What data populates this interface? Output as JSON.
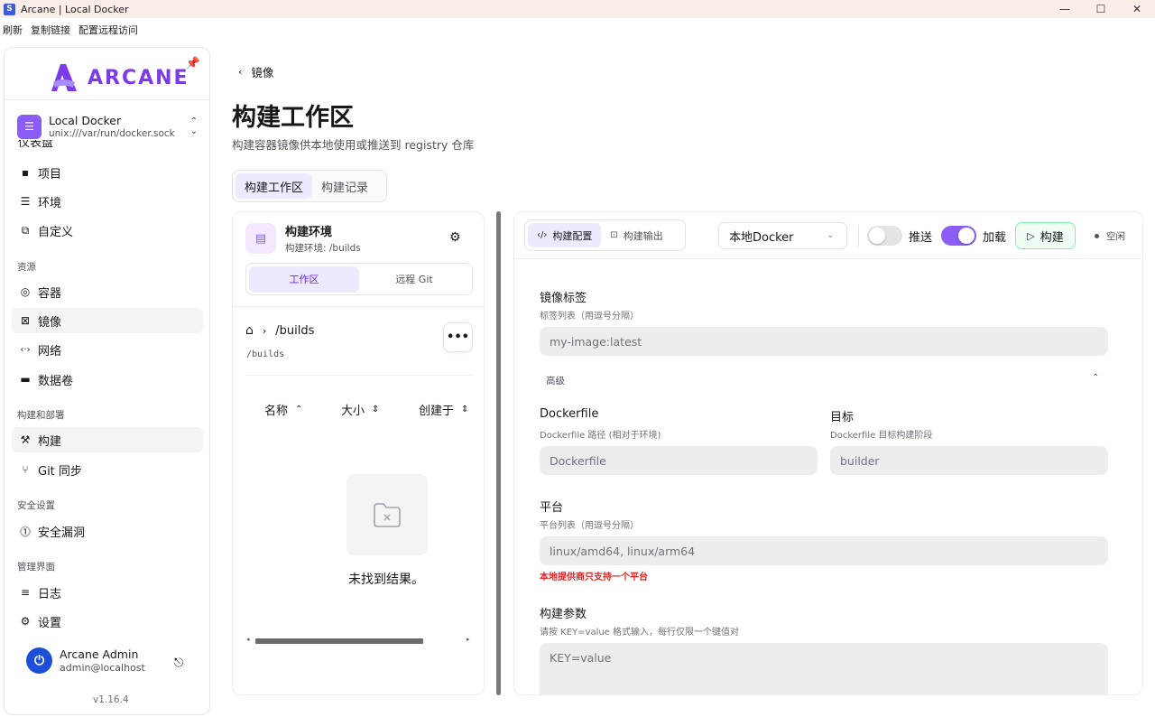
{
  "window": {
    "title": "Arcane | Local Docker",
    "icon_letter": "S",
    "minimize": "—",
    "maximize": "☐",
    "close": "✕"
  },
  "menubar": {
    "refresh": "刷新",
    "copy_link": "复制链接",
    "remote": "配置远程访问"
  },
  "sidebar": {
    "brand": "ARCANE",
    "env_name": "Local Docker",
    "env_socket": "unix:///var/run/docker.sock",
    "partial_item": "仪表盘",
    "items_top": [
      {
        "label": "项目",
        "icon": "▪"
      },
      {
        "label": "环境",
        "icon": "☰"
      },
      {
        "label": "自定义",
        "icon": "⧉"
      }
    ],
    "section_resources": "资源",
    "items_resources": [
      {
        "label": "容器",
        "icon": "◎"
      },
      {
        "label": "镜像",
        "icon": "⊠"
      },
      {
        "label": "网络",
        "icon": "‹·›"
      },
      {
        "label": "数据卷",
        "icon": "▬"
      }
    ],
    "section_build": "构建和部署",
    "items_build": [
      {
        "label": "构建",
        "icon": "⚒"
      },
      {
        "label": "Git 同步",
        "icon": "⑂"
      }
    ],
    "section_security": "安全设置",
    "items_security": [
      {
        "label": "安全漏洞",
        "icon": "⓵"
      }
    ],
    "section_admin": "管理界面",
    "items_admin": [
      {
        "label": "日志",
        "icon": "≡"
      },
      {
        "label": "设置",
        "icon": "⚙"
      }
    ],
    "user_name": "Arcane Admin",
    "user_email": "admin@localhost",
    "version": "v1.16.4"
  },
  "header": {
    "back_label": "镜像",
    "title": "构建工作区",
    "subtitle": "构建容器镜像供本地使用或推送到 registry 仓库",
    "tabs": [
      "构建工作区",
      "构建记录"
    ]
  },
  "left_panel": {
    "env_title": "构建环境",
    "env_sub": "构建环境: /builds",
    "seg": [
      "工作区",
      "远程 Git"
    ],
    "crumb": "/builds",
    "path": "/builds",
    "columns": [
      "名称",
      "大小",
      "创建于"
    ],
    "empty_text": "未找到结果。"
  },
  "right_panel": {
    "tabs": [
      "构建配置",
      "构建输出"
    ],
    "provider": "本地Docker",
    "push_label": "推送",
    "load_label": "加载",
    "build_label": "构建",
    "status": "空闲",
    "tags_label": "镜像标签",
    "tags_hint": "标签列表（用逗号分隔）",
    "tags_placeholder": "my-image:latest",
    "advanced": "高级",
    "dockerfile_label": "Dockerfile",
    "dockerfile_hint": "Dockerfile 路径 (相对于环境)",
    "dockerfile_placeholder": "Dockerfile",
    "target_label": "目标",
    "target_hint": "Dockerfile 目标构建阶段",
    "target_placeholder": "builder",
    "platform_label": "平台",
    "platform_hint": "平台列表（用逗号分隔）",
    "platform_placeholder": "linux/amd64, linux/arm64",
    "platform_error": "本地提供商只支持一个平台",
    "args_label": "构建参数",
    "args_hint": "请按 KEY=value 格式输入，每行仅限一个键值对",
    "args_placeholder": "KEY=value",
    "push_on": false,
    "load_on": true
  },
  "colors": {
    "accent": "#8b5cf6",
    "accent_soft": "#ede9fe",
    "error": "#dc2626"
  }
}
